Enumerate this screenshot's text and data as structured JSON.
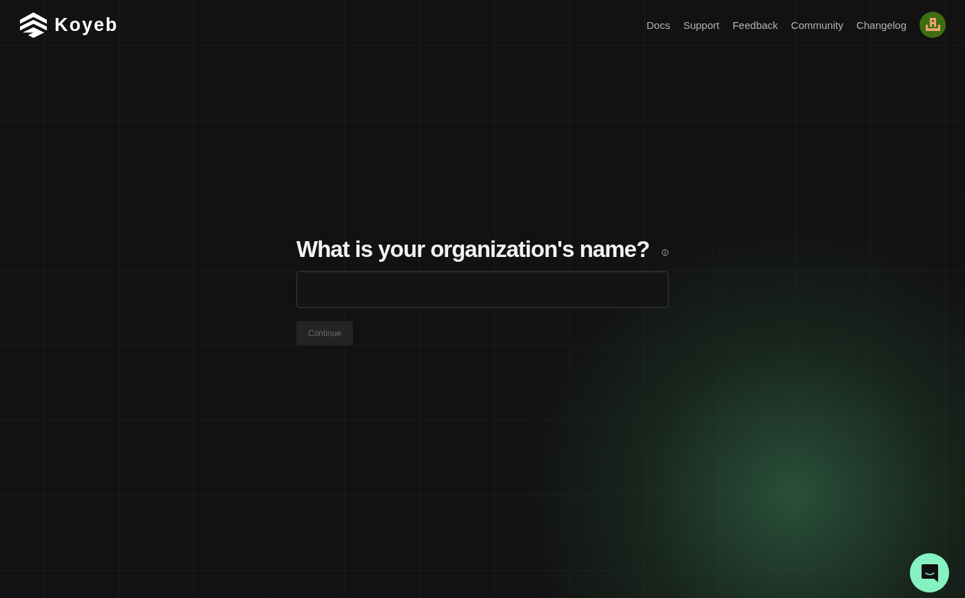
{
  "header": {
    "brand": "Koyeb",
    "nav": [
      "Docs",
      "Support",
      "Feedback",
      "Community",
      "Changelog"
    ]
  },
  "form": {
    "question": "What is your organization's name?",
    "button": {
      "label": "Continue",
      "disabled": true
    }
  }
}
